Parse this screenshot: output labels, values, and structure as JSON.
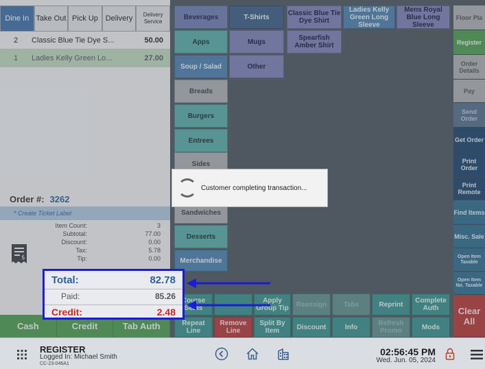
{
  "order_tabs": [
    {
      "label": "Dine In"
    },
    {
      "label": "Take Out"
    },
    {
      "label": "Pick Up"
    },
    {
      "label": "Delivery"
    },
    {
      "label": "Delivery Service"
    }
  ],
  "items": [
    {
      "qty": "2",
      "name": "Classic Blue Tie Dye S...",
      "price": "50.00"
    },
    {
      "qty": "1",
      "name": "Ladies Kelly Green Lo...",
      "price": "27.00"
    }
  ],
  "order": {
    "label": "Order #:",
    "number": "3262",
    "ticket_placeholder": "* Create Ticket Label"
  },
  "summary": {
    "item_count_label": "Item Count:",
    "item_count": "3",
    "subtotal_label": "Subtotal:",
    "subtotal": "77.00",
    "discount_label": "Discount:",
    "discount": "0.00",
    "tax_label": "Tax:",
    "tax": "5.78",
    "tip_label": "Tip:",
    "tip": "0.00"
  },
  "totals": {
    "total_label": "Total:",
    "total": "82.78",
    "paid_label": "Paid:",
    "paid": "85.26",
    "credit_label": "Credit:",
    "credit": "2.48"
  },
  "pay_buttons": {
    "cash": "Cash",
    "credit": "Credit",
    "tab_auth": "Tab Auth"
  },
  "categories": {
    "beverages": "Beverages",
    "tshirts": "T-Shirts",
    "apps": "Apps",
    "mugs": "Mugs",
    "soup_salad": "Soup / Salad",
    "other": "Other",
    "breads": "Breads",
    "burgers": "Burgers",
    "entrees": "Entrees",
    "sides": "Sides",
    "sandwiches": "Sandwiches",
    "desserts": "Desserts",
    "merchandise": "Merchandise"
  },
  "products": {
    "classic_blue": "Classic Blue Tie Dye Shirt",
    "ladies_kelly": "Ladies Kelly Green Long Sleeve",
    "mens_royal": "Mens Royal Blue Long Sleeve",
    "spearfish": "Spearfish Amber Shirt"
  },
  "actions": {
    "course_seats": "Course Seats",
    "apply_group_tip": "Apply Group Tip",
    "reassign": "Reassign",
    "tabs": "Tabs",
    "reprint": "Reprint",
    "complete_auth": "Complete Auth",
    "repeat_line": "Repeat Line",
    "remove_line": "Remove Line",
    "split_by_item": "Split By Item",
    "discount": "Discount",
    "info": "Info",
    "refresh_promo": "Refresh Promo",
    "mods": "Mods"
  },
  "right_rail": {
    "floor_plan": "Floor Pla",
    "register": "Register",
    "order_details": "Order Details",
    "pay": "Pay",
    "send_order": "Send Order",
    "get_order": "Get Order",
    "print_order": "Print Order",
    "print_remote": "Print Remote",
    "find_items": "Find Items",
    "misc_sale": "Misc. Sale",
    "open_item_taxable": "Open Item Taxable",
    "open_item_no_taxable": "Open Item No. Taxable",
    "clear_all": "Clear All"
  },
  "dialog": {
    "message": "Customer completing transaction..."
  },
  "bottom_bar": {
    "title": "REGISTER",
    "logged_in": "Logged In:  Michael Smith",
    "device_id": "CC-23-046A1",
    "time": "02:56:45 PM",
    "date": "Wed. Jun. 05, 2024"
  },
  "colors": {
    "accent_blue": "#3f6fa6",
    "highlight_border": "#1b1bdc",
    "credit_red": "#c62828",
    "pay_green": "#4c9a50"
  }
}
